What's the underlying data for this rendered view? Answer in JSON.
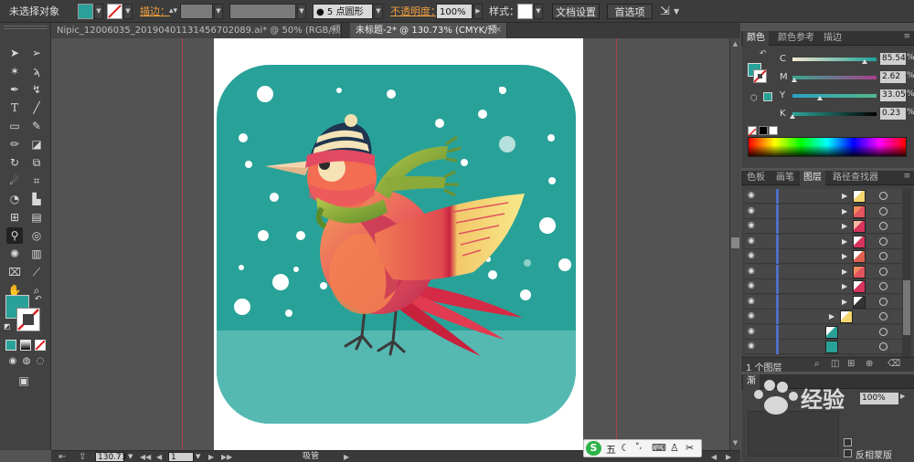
{
  "control_bar": {
    "selection_status": "未选择对象",
    "stroke_label": "描边：",
    "brush_size": "5",
    "brush_name": "点圆形",
    "opacity_label": "不透明度：",
    "opacity_value": "100%",
    "style_label": "样式：",
    "doc_setup": "文档设置",
    "preferences": "首选项"
  },
  "tabs": [
    {
      "label": "Nipic_12006035_20190401131456702089.ai* @ 50% (RGB/预览)",
      "close": "×"
    },
    {
      "label": "未标题-2* @ 130.73% (CMYK/预览)",
      "close": "×"
    }
  ],
  "status_bar": {
    "zoom": "130.73",
    "page": "1",
    "tool_name": "吸管"
  },
  "ime": {
    "label": "五"
  },
  "color_panel": {
    "tabs": [
      "颜色",
      "颜色参考",
      "描边"
    ],
    "channels": [
      {
        "ch": "C",
        "value": "85.54",
        "unit": "%",
        "level": 0.855,
        "track": "linear-gradient(to right,#f6e7d0,#1ca19a)"
      },
      {
        "ch": "M",
        "value": "2.62",
        "unit": "%",
        "level": 0.026,
        "track": "linear-gradient(to right,#3aa68e,#a6418c)"
      },
      {
        "ch": "Y",
        "value": "33.05",
        "unit": "%",
        "level": 0.33,
        "track": "linear-gradient(to right,#2aa2c2,#53b98a)"
      },
      {
        "ch": "K",
        "value": "0.23",
        "unit": "%",
        "level": 0.002,
        "track": "linear-gradient(to right,#2ea79c,#000000)"
      }
    ],
    "fill_color": "#2aa198"
  },
  "layers_panel": {
    "tabs": [
      "色板",
      "画笔",
      "图层",
      "路径查找器"
    ],
    "footer": "1 个图层",
    "rows": [
      {
        "thumb": "#ffffff",
        "accent": "#f5d76e",
        "expand": true,
        "indent": 0
      },
      {
        "thumb": "#f08a5d",
        "accent": "#e0555e",
        "expand": true,
        "indent": 0
      },
      {
        "thumb": "#f4b7a0",
        "accent": "#d6345c",
        "expand": true,
        "indent": 0
      },
      {
        "thumb": "#ffffff",
        "accent": "#d6345c",
        "expand": true,
        "indent": 0
      },
      {
        "thumb": "#ffffff",
        "accent": "#e06050",
        "expand": true,
        "indent": 0
      },
      {
        "thumb": "#f08a5d",
        "accent": "#e0555e",
        "expand": true,
        "indent": 0
      },
      {
        "thumb": "#ffffff",
        "accent": "#d6345c",
        "expand": true,
        "indent": 0
      },
      {
        "thumb": "#ffffff",
        "accent": "#333333",
        "expand": true,
        "indent": 0
      },
      {
        "thumb": "#ffffff",
        "accent": "#f5d76e",
        "expand": true,
        "indent": -14
      },
      {
        "thumb": "#ffffff",
        "accent": "#2aa198",
        "expand": false,
        "indent": -30
      },
      {
        "thumb": "#2aa198",
        "accent": "#2aa198",
        "expand": false,
        "indent": -30
      }
    ]
  },
  "bottom_panel": {
    "tab": "渐",
    "opacity_value": "100%",
    "option": "反相蒙版",
    "watermark": "经验"
  },
  "artwork": {
    "background": "#28a298",
    "ground": "#55b9b2"
  }
}
